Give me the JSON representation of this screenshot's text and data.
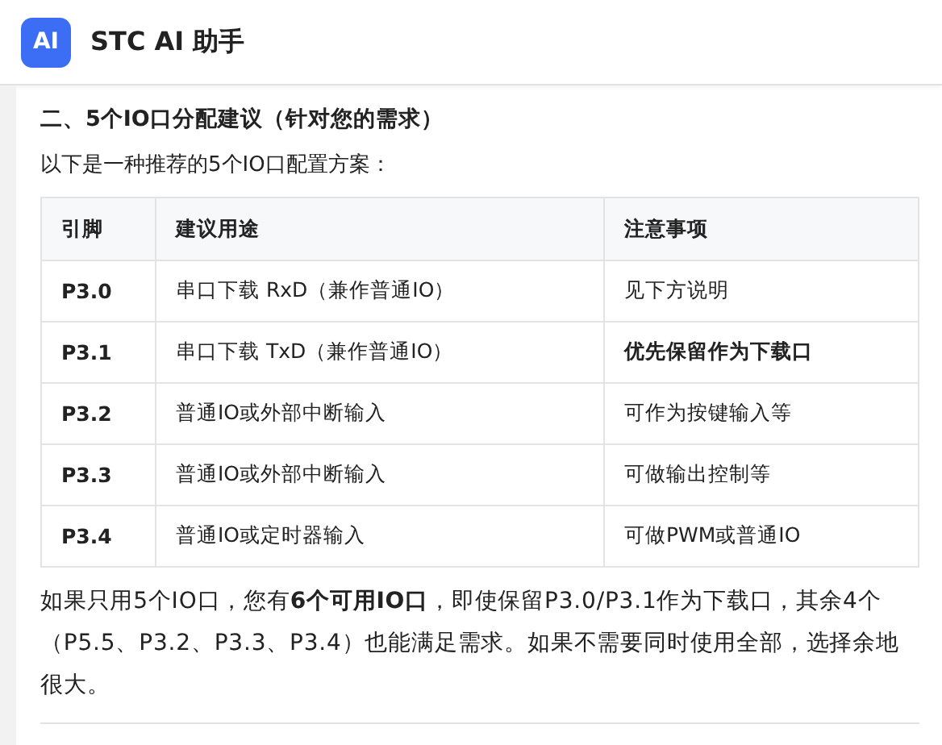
{
  "header": {
    "logo": "AI",
    "title": "STC AI 助手"
  },
  "section": {
    "heading": "二、5个IO口分配建议（针对您的需求）",
    "intro": "以下是一种推荐的5个IO口配置方案：",
    "table": {
      "columns": [
        "引脚",
        "建议用途",
        "注意事项"
      ],
      "rows": [
        {
          "pin": "P3.0",
          "use": "串口下载 RxD（兼作普通IO）",
          "note": "见下方说明",
          "note_bold": false
        },
        {
          "pin": "P3.1",
          "use": "串口下载 TxD（兼作普通IO）",
          "note": "优先保留作为下载口",
          "note_bold": true
        },
        {
          "pin": "P3.2",
          "use": "普通IO或外部中断输入",
          "note": "可作为按键输入等",
          "note_bold": false
        },
        {
          "pin": "P3.3",
          "use": "普通IO或外部中断输入",
          "note": "可做输出控制等",
          "note_bold": false
        },
        {
          "pin": "P3.4",
          "use": "普通IO或定时器输入",
          "note": "可做PWM或普通IO",
          "note_bold": false
        }
      ]
    },
    "summary": "如果只用5个IO口，您有**6个可用IO口**，即使保留P3.0/P3.1作为下载口，其余4个（P5.5、P3.2、P3.3、P3.4）也能满足需求。如果不需要同时使用全部，选择余地很大。"
  }
}
